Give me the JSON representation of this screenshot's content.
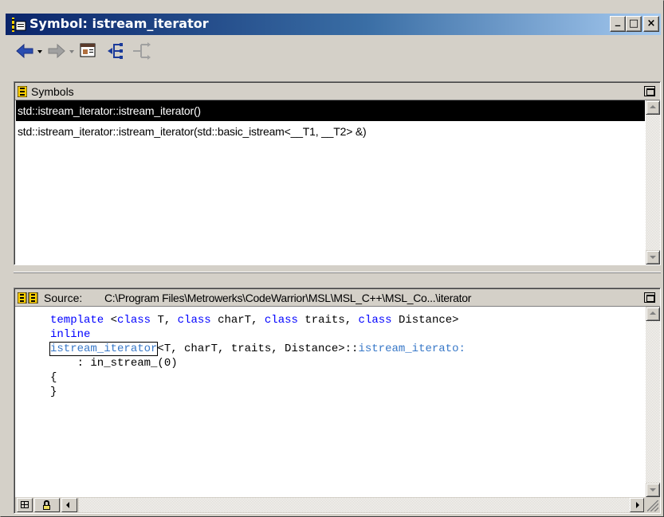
{
  "window": {
    "title": "Symbol: istream_iterator",
    "controls": {
      "minimize": "_",
      "maximize": "□",
      "close": "×"
    }
  },
  "toolbar": {
    "buttons": [
      {
        "name": "back",
        "icon": "back-arrow-icon"
      },
      {
        "name": "forward",
        "icon": "forward-arrow-icon"
      },
      {
        "name": "browse",
        "icon": "browser-icon"
      },
      {
        "name": "hierarchy",
        "icon": "hierarchy-icon"
      },
      {
        "name": "hierarchy-disabled",
        "icon": "hierarchy-alt-icon"
      }
    ]
  },
  "symbols_pane": {
    "header": "Symbols",
    "items": [
      {
        "label": "std::istream_iterator::istream_iterator()",
        "selected": true
      },
      {
        "label": "std::istream_iterator::istream_iterator(std::basic_istream<__T1, __T2> &)",
        "selected": false
      }
    ]
  },
  "source_pane": {
    "header_label": "Source:",
    "path": "C:\\Program Files\\Metrowerks\\CodeWarrior\\MSL\\MSL_C++\\MSL_Co...\\iterator",
    "code": {
      "line1": {
        "kw1": "template",
        "t1": " <",
        "kw2": "class",
        "t2": " T, ",
        "kw3": "class",
        "t3": " charT, ",
        "kw4": "class",
        "t4": " traits, ",
        "kw5": "class",
        "t5": " Distance>"
      },
      "line2": {
        "kw": "inline"
      },
      "line3": {
        "sym1": "istream_iterator",
        "t1": "<T, charT, traits, Distance>::",
        "sym2": "istream_iterato:"
      },
      "line4": "    : in_stream_(0)",
      "line5": "{",
      "line6": "}"
    }
  },
  "colors": {
    "keyword": "#0000ff",
    "symbol": "#3878c8",
    "title_active": "#0a246a"
  }
}
